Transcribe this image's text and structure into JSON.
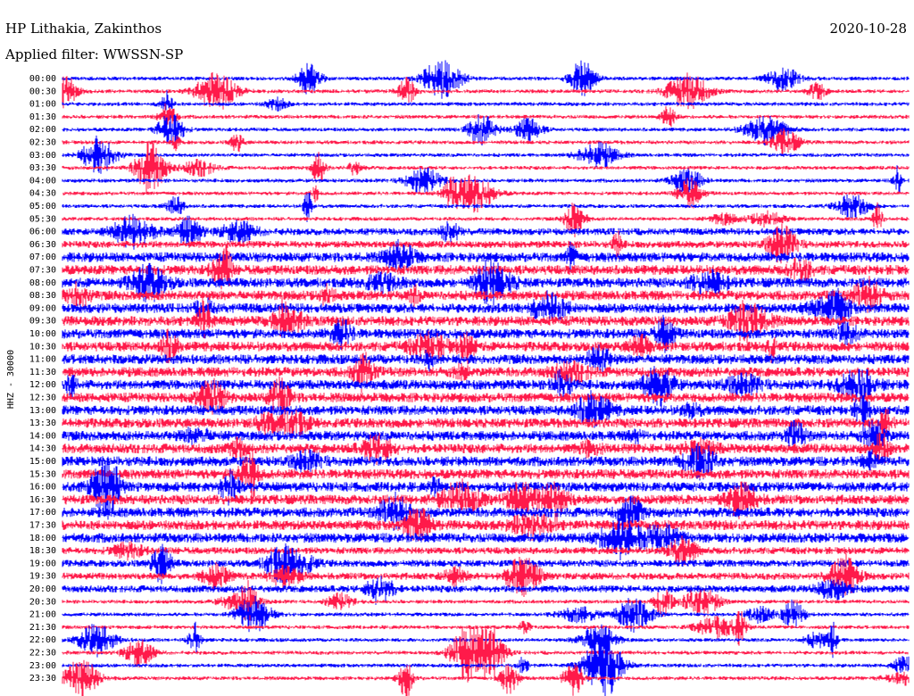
{
  "header": {
    "station": "HP Lithakia, Zakinthos",
    "filter": "Applied filter: WWSSN-SP",
    "date": "2020-10-28"
  },
  "chart_data": {
    "type": "line",
    "title": "HP Lithakia, Zakinthos",
    "subtitle": "Applied filter: WWSSN-SP",
    "ylabel": "HHZ - 30000",
    "ticks": [
      "00:00",
      "00:30",
      "01:00",
      "01:30",
      "02:00",
      "02:30",
      "03:00",
      "03:30",
      "04:00",
      "04:30",
      "05:00",
      "05:30",
      "06:00",
      "06:30",
      "07:00",
      "07:30",
      "08:00",
      "08:30",
      "09:00",
      "09:30",
      "10:00",
      "10:30",
      "11:00",
      "11:30",
      "12:00",
      "12:30",
      "13:00",
      "13:30",
      "14:00",
      "14:30",
      "15:00",
      "15:30",
      "16:00",
      "16:30",
      "17:00",
      "17:30",
      "18:00",
      "18:30",
      "19:00",
      "19:30",
      "20:00",
      "20:30",
      "21:00",
      "21:30",
      "22:00",
      "22:30",
      "23:00",
      "23:30"
    ],
    "colors": [
      "#0000ff",
      "#ff1a4a"
    ],
    "grid": false,
    "legend": "none",
    "traces_per_row_note": "none"
  }
}
